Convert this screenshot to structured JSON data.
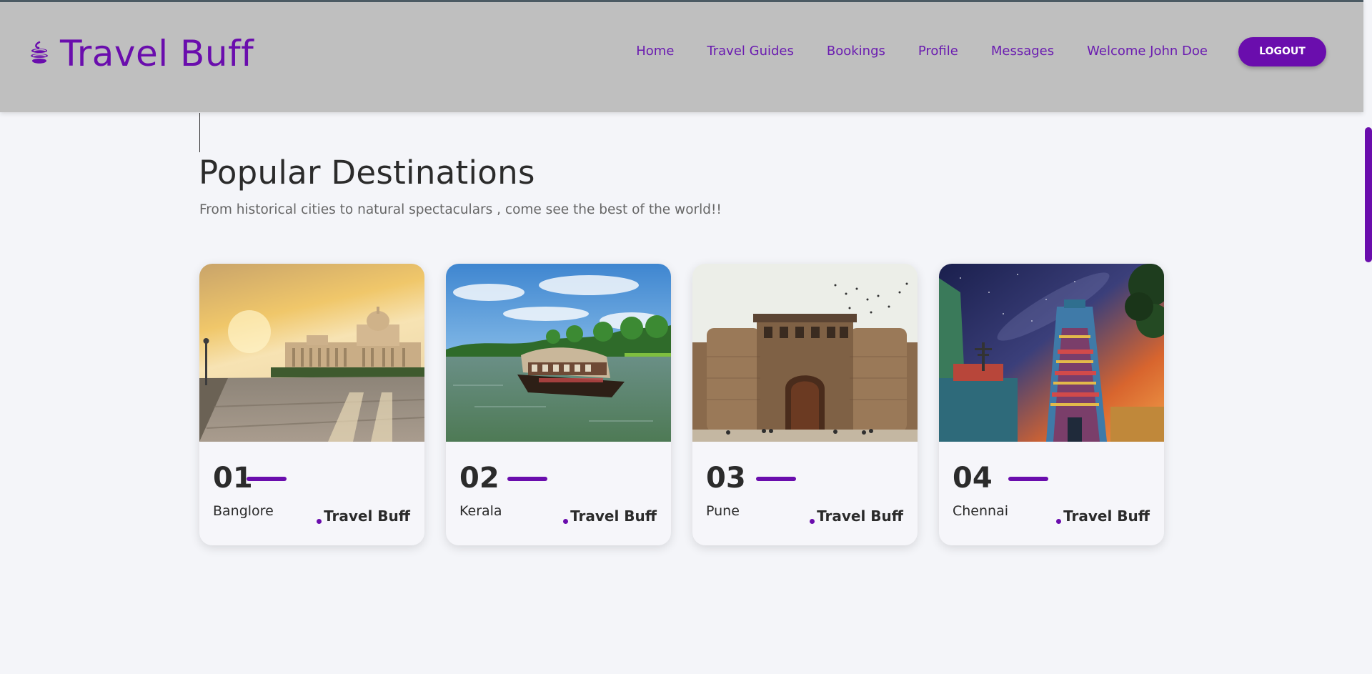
{
  "header": {
    "brand_name": "Travel Buff",
    "brand_icon": "swirl-logo-icon",
    "nav": [
      {
        "label": "Home"
      },
      {
        "label": "Travel Guides"
      },
      {
        "label": "Bookings"
      },
      {
        "label": "Profile"
      },
      {
        "label": "Messages"
      },
      {
        "label": "Welcome John Doe"
      }
    ],
    "logout_label": "LOGOUT"
  },
  "section": {
    "title": "Popular Destinations",
    "subtitle": "From historical cities to natural spectaculars , come see the best of the world!!"
  },
  "cards": [
    {
      "number": "01",
      "city": "Banglore",
      "brand": "Travel Buff"
    },
    {
      "number": "02",
      "city": "Kerala",
      "brand": "Travel Buff"
    },
    {
      "number": "03",
      "city": "Pune",
      "brand": "Travel Buff"
    },
    {
      "number": "04",
      "city": "Chennai",
      "brand": "Travel Buff"
    }
  ],
  "colors": {
    "accent": "#6a0dad",
    "header_bg": "#bfbfbf",
    "page_bg": "#f4f5f9"
  }
}
